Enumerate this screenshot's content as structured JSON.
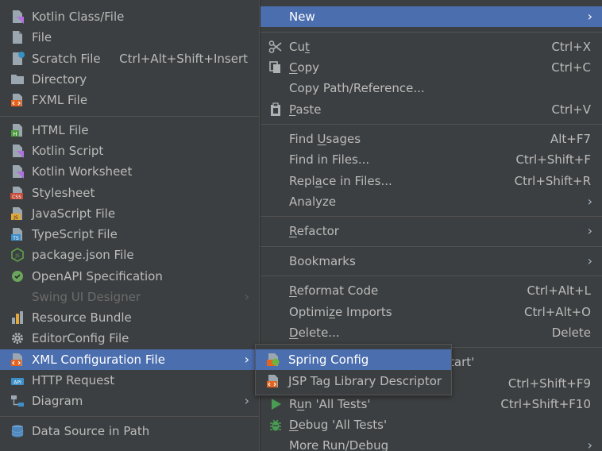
{
  "left_menu": {
    "items": [
      {
        "label": "Kotlin Class/File",
        "icon": "kotlin-class-icon"
      },
      {
        "label": "File",
        "icon": "file-icon"
      },
      {
        "label": "Scratch File",
        "shortcut": "Ctrl+Alt+Shift+Insert",
        "icon": "scratch-file-icon"
      },
      {
        "label": "Directory",
        "icon": "folder-icon"
      },
      {
        "label": "FXML File",
        "icon": "fxml-file-icon"
      },
      {
        "label": "HTML File",
        "icon": "html-file-icon"
      },
      {
        "label": "Kotlin Script",
        "icon": "kotlin-script-icon"
      },
      {
        "label": "Kotlin Worksheet",
        "icon": "kotlin-worksheet-icon"
      },
      {
        "label": "Stylesheet",
        "icon": "css-file-icon"
      },
      {
        "label": "JavaScript File",
        "icon": "javascript-file-icon"
      },
      {
        "label": "TypeScript File",
        "icon": "typescript-file-icon"
      },
      {
        "label": "package.json File",
        "icon": "nodejs-icon"
      },
      {
        "label": "OpenAPI Specification",
        "icon": "openapi-icon"
      },
      {
        "label": "Swing UI Designer",
        "disabled": true
      },
      {
        "label": "Resource Bundle",
        "icon": "resource-bundle-icon"
      },
      {
        "label": "EditorConfig File",
        "icon": "gear-icon"
      },
      {
        "label": "XML Configuration File",
        "icon": "xml-file-icon",
        "selected": true
      },
      {
        "label": "HTTP Request",
        "icon": "api-icon"
      },
      {
        "label": "Diagram",
        "icon": "diagram-icon"
      },
      {
        "label": "Data Source in Path",
        "icon": "database-icon"
      }
    ]
  },
  "context_menu": {
    "new_label": "New",
    "cut": {
      "pre": "Cu",
      "mn": "t",
      "post": "",
      "shortcut": "Ctrl+X"
    },
    "copy": {
      "pre": "",
      "mn": "C",
      "post": "opy",
      "shortcut": "Ctrl+C"
    },
    "copy_path": "Copy Path/Reference...",
    "paste": {
      "pre": "",
      "mn": "P",
      "post": "aste",
      "shortcut": "Ctrl+V"
    },
    "find_usages": {
      "pre": "Find ",
      "mn": "U",
      "post": "sages",
      "shortcut": "Alt+F7"
    },
    "find_in_files": {
      "label": "Find in Files...",
      "shortcut": "Ctrl+Shift+F"
    },
    "replace_in_files": {
      "pre": "Repl",
      "mn": "a",
      "post": "ce in Files...",
      "shortcut": "Ctrl+Shift+R"
    },
    "analyze": "Analyze",
    "refactor": {
      "pre": "",
      "mn": "R",
      "post": "efactor"
    },
    "bookmarks": "Bookmarks",
    "reformat_code": {
      "pre": "",
      "mn": "R",
      "post": "eformat Code",
      "shortcut": "Ctrl+Alt+L"
    },
    "optimize_imports": {
      "pre": "Optimi",
      "mn": "z",
      "post": "e Imports",
      "shortcut": "Ctrl+Alt+O"
    },
    "delete": {
      "pre": "",
      "mn": "D",
      "post": "elete...",
      "shortcut": "Delete"
    },
    "partial_text": "tart'",
    "partial_shortcut": "Ctrl+Shift+F9",
    "run_tests": {
      "pre": "R",
      "mn": "u",
      "post": "n 'All Tests'",
      "shortcut": "Ctrl+Shift+F10"
    },
    "debug_tests": {
      "pre": "",
      "mn": "D",
      "post": "ebug 'All Tests'"
    },
    "more_run_debug": "More Run/Debug"
  },
  "submenu": {
    "items": [
      {
        "label": "Spring Config",
        "icon": "spring-config-icon",
        "selected": true
      },
      {
        "label": "JSP Tag Library Descriptor",
        "icon": "xml-file-icon"
      }
    ]
  },
  "colors": {
    "menu_bg": "#3c3f41",
    "selected": "#4b6eaf",
    "text": "#bbbbbb",
    "disabled": "#6b6b6b"
  }
}
